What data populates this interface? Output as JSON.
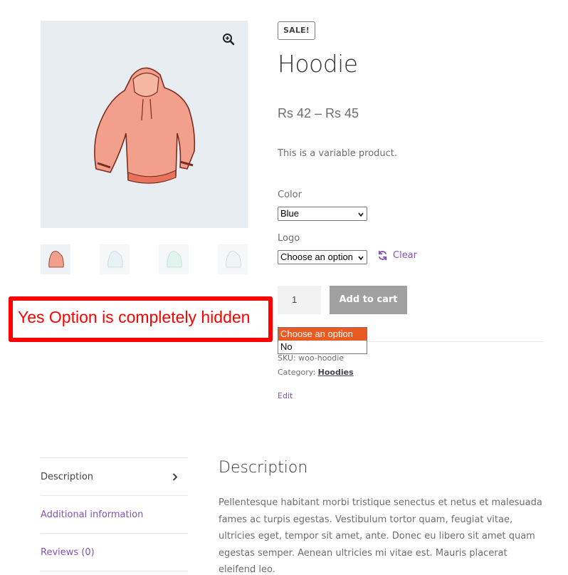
{
  "product": {
    "sale_badge": "SALE!",
    "title": "Hoodie",
    "price": "Rs 42 – Rs 45",
    "short_description": "This is a variable product."
  },
  "variations": {
    "color_label": "Color",
    "color_selected": "Blue",
    "logo_label": "Logo",
    "logo_selected": "Choose an option",
    "clear_label": "Clear",
    "logo_options": [
      "Choose an option",
      "No"
    ]
  },
  "cart": {
    "quantity": "1",
    "add_to_cart_label": "Add to cart"
  },
  "meta": {
    "sku": "SKU: woo-hoodie",
    "category_prefix": "Category: ",
    "category_link": "Hoodies",
    "edit_label": "Edit"
  },
  "annotation": {
    "text": "Yes Option is completely hidden",
    "color": "#ff0000"
  },
  "tabs": [
    {
      "label": "Description"
    },
    {
      "label": "Additional information"
    },
    {
      "label": "Reviews (0)"
    }
  ],
  "description": {
    "heading": "Description",
    "body": "Pellentesque habitant morbi tristique senectus et netus et malesuada fames ac turpis egestas. Vestibulum tortor quam, feugiat vitae, ultricies eget, tempor sit amet, ante. Donec eu libero sit amet quam egestas semper. Aenean ultricies mi vitae est. Mauris placerat eleifend leo."
  },
  "icons": {
    "zoom": "zoom-in-icon",
    "clear": "refresh-icon",
    "tab_arrow": "chevron-right-icon"
  },
  "colors": {
    "accent": "#7f54b3",
    "highlight": "#ea5b23",
    "button_disabled": "#a0a0a0",
    "product_bg": "#e8edf1"
  }
}
